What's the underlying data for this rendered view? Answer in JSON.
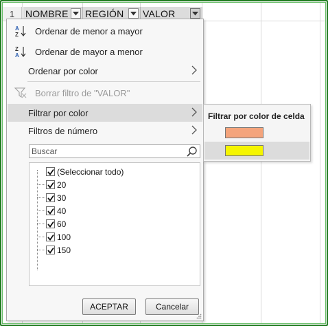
{
  "sheet": {
    "row_number": "1",
    "headers": [
      {
        "label": "NOMBRE"
      },
      {
        "label": "REGIÓN"
      },
      {
        "label": "VALOR"
      }
    ]
  },
  "menu": {
    "sort_asc": "Ordenar de menor a mayor",
    "sort_desc": "Ordenar de mayor a menor",
    "sort_by_color": "Ordenar por color",
    "clear_filter": "Borrar filtro de \"VALOR\"",
    "filter_by_color": "Filtrar por color",
    "number_filters": "Filtros de número",
    "search_placeholder": "Buscar",
    "items": [
      {
        "label": "(Seleccionar todo)",
        "checked": true
      },
      {
        "label": "20",
        "checked": true
      },
      {
        "label": "30",
        "checked": true
      },
      {
        "label": "40",
        "checked": true
      },
      {
        "label": "60",
        "checked": true
      },
      {
        "label": "100",
        "checked": true
      },
      {
        "label": "150",
        "checked": true
      }
    ],
    "ok_label": "ACEPTAR",
    "cancel_label": "Cancelar"
  },
  "submenu": {
    "title": "Filtrar por color de celda",
    "colors": [
      "#f4a47c",
      "#f5f500"
    ]
  },
  "icons": {
    "sort_asc": "sort-ascending-icon",
    "sort_desc": "sort-descending-icon",
    "clear_filter": "clear-filter-icon",
    "search": "search-icon",
    "dropdown": "dropdown-arrow-icon",
    "submenu": "chevron-right-icon"
  },
  "colors": {
    "frame": "#1f7a1f",
    "header_bg": "#dcdcdc",
    "menu_bg": "#f7f7f7",
    "hover": "#dcdcdc"
  }
}
